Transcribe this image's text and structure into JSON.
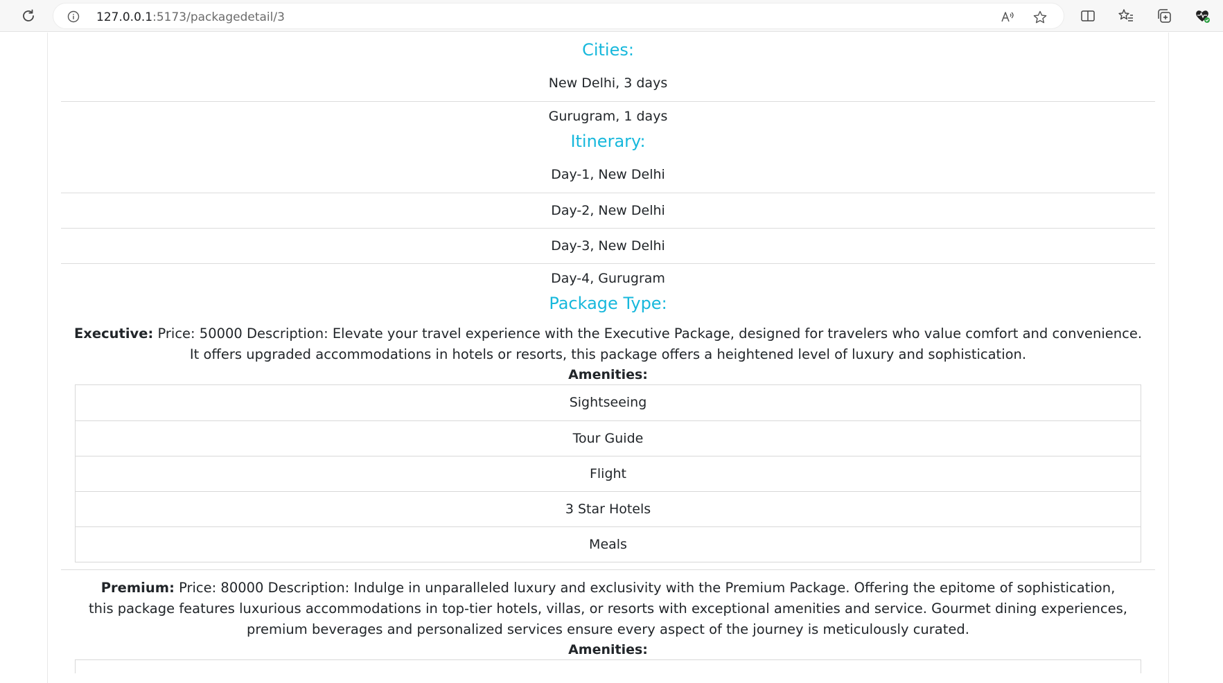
{
  "browser": {
    "url_host": "127.0.0.1",
    "url_path": ":5173/packagedetail/3"
  },
  "cities": {
    "heading": "Cities:",
    "items": [
      "New Delhi, 3 days",
      "Gurugram, 1 days"
    ]
  },
  "itinerary": {
    "heading": "Itinerary:",
    "items": [
      "Day-1, New Delhi",
      "Day-2, New Delhi",
      "Day-3, New Delhi",
      "Day-4, Gurugram"
    ]
  },
  "package_type": {
    "heading": "Package Type:",
    "packages": [
      {
        "name": "Executive:",
        "details": "Price: 50000 Description: Elevate your travel experience with the Executive Package, designed for travelers who value comfort and convenience. It offers upgraded accommodations in hotels or resorts, this package offers a heightened level of luxury and sophistication.",
        "amenities_label": "Amenities:",
        "amenities": [
          "Sightseeing",
          "Tour Guide",
          "Flight",
          "3 Star Hotels",
          "Meals"
        ]
      },
      {
        "name": "Premium:",
        "details": "Price: 80000 Description: Indulge in unparalleled luxury and exclusivity with the Premium Package. Offering the epitome of sophistication, this package features luxurious accommodations in top-tier hotels, villas, or resorts with exceptional amenities and service. Gourmet dining experiences, premium beverages and personalized services ensure every aspect of the journey is meticulously curated.",
        "amenities_label": "Amenities:"
      }
    ]
  },
  "colors": {
    "heading": "#17b8dc",
    "text": "#212529"
  }
}
